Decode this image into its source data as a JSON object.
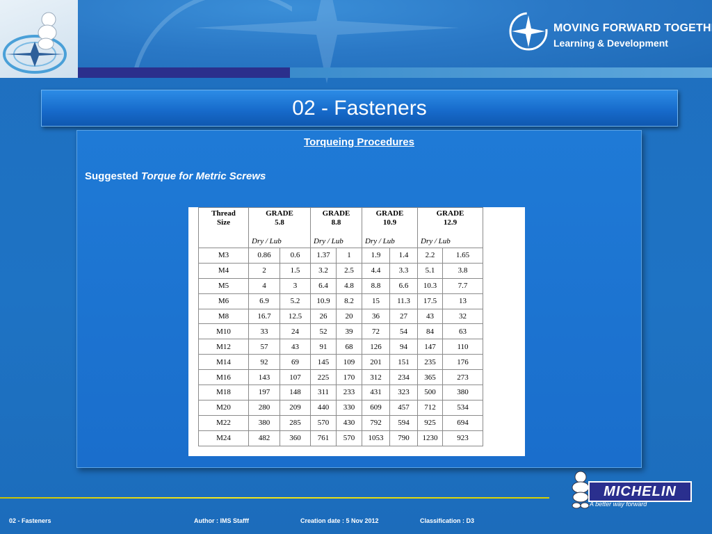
{
  "header": {
    "brand_line1": "MOVING FORWARD TOGETHER",
    "brand_line2": "Learning & Development"
  },
  "slide": {
    "title": "02 -  Fasteners",
    "heading": "Torqueing Procedures",
    "subheading_plain": "Suggested ",
    "subheading_italic": "Torque for Metric Screws"
  },
  "table": {
    "headers": [
      {
        "line1": "Thread",
        "line2": "Size",
        "drylub": ""
      },
      {
        "line1": "GRADE",
        "line2": "5.8",
        "drylub": "Dry /  Lub"
      },
      {
        "line1": "GRADE",
        "line2": "8.8",
        "drylub": "Dry /  Lub"
      },
      {
        "line1": "GRADE",
        "line2": "10.9",
        "drylub": "Dry /  Lub"
      },
      {
        "line1": "GRADE",
        "line2": "12.9",
        "drylub": "Dry /  Lub"
      }
    ],
    "rows": [
      [
        "M3",
        "0.86",
        "0.6",
        "1.37",
        "1",
        "1.9",
        "1.4",
        "2.2",
        "1.65"
      ],
      [
        "M4",
        "2",
        "1.5",
        "3.2",
        "2.5",
        "4.4",
        "3.3",
        "5.1",
        "3.8"
      ],
      [
        "M5",
        "4",
        "3",
        "6.4",
        "4.8",
        "8.8",
        "6.6",
        "10.3",
        "7.7"
      ],
      [
        "M6",
        "6.9",
        "5.2",
        "10.9",
        "8.2",
        "15",
        "11.3",
        "17.5",
        "13"
      ],
      [
        "M8",
        "16.7",
        "12.5",
        "26",
        "20",
        "36",
        "27",
        "43",
        "32"
      ],
      [
        "M10",
        "33",
        "24",
        "52",
        "39",
        "72",
        "54",
        "84",
        "63"
      ],
      [
        "M12",
        "57",
        "43",
        "91",
        "68",
        "126",
        "94",
        "147",
        "110"
      ],
      [
        "M14",
        "92",
        "69",
        "145",
        "109",
        "201",
        "151",
        "235",
        "176"
      ],
      [
        "M16",
        "143",
        "107",
        "225",
        "170",
        "312",
        "234",
        "365",
        "273"
      ],
      [
        "M18",
        "197",
        "148",
        "311",
        "233",
        "431",
        "323",
        "500",
        "380"
      ],
      [
        "M20",
        "280",
        "209",
        "440",
        "330",
        "609",
        "457",
        "712",
        "534"
      ],
      [
        "M22",
        "380",
        "285",
        "570",
        "430",
        "792",
        "594",
        "925",
        "694"
      ],
      [
        "M24",
        "482",
        "360",
        "761",
        "570",
        "1053",
        "790",
        "1230",
        "923"
      ]
    ]
  },
  "michelin": {
    "label": "MICHELIN",
    "tagline": "A better way forward"
  },
  "footer": {
    "title": "02 - Fasteners",
    "author": "Author : IMS Stafff",
    "created": "Creation date : 5 Nov 2012",
    "classification": "Classification : D3"
  }
}
